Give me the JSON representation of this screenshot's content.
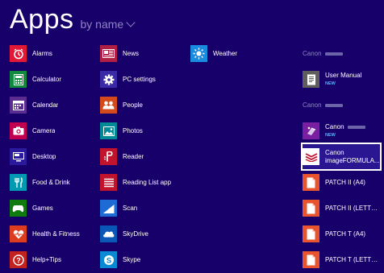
{
  "header": {
    "title": "Apps",
    "sort_label": "by name"
  },
  "columns": [
    {
      "items": [
        {
          "label": "Alarms",
          "icon": "alarm-icon",
          "color": "#e31837"
        },
        {
          "label": "Calculator",
          "icon": "calculator-icon",
          "color": "#118a3e"
        },
        {
          "label": "Calendar",
          "icon": "calendar-icon",
          "color": "#5c2d91"
        },
        {
          "label": "Camera",
          "icon": "camera-icon",
          "color": "#c1004f"
        },
        {
          "label": "Desktop",
          "icon": "desktop-icon",
          "color": "#2b1b9c"
        },
        {
          "label": "Food & Drink",
          "icon": "food-drink-icon",
          "color": "#009ab3"
        },
        {
          "label": "Games",
          "icon": "games-icon",
          "color": "#0f7b0f"
        },
        {
          "label": "Health & Fitness",
          "icon": "health-fitness-icon",
          "color": "#dd3c1f"
        },
        {
          "label": "Help+Tips",
          "icon": "help-icon",
          "color": "#c4221f"
        }
      ]
    },
    {
      "items": [
        {
          "label": "News",
          "icon": "news-icon",
          "color": "#b01e45"
        },
        {
          "label": "PC settings",
          "icon": "gear-icon",
          "color": "#3a2aa6"
        },
        {
          "label": "People",
          "icon": "people-icon",
          "color": "#d44a1c"
        },
        {
          "label": "Photos",
          "icon": "photos-icon",
          "color": "#008a96"
        },
        {
          "label": "Reader",
          "icon": "reader-icon",
          "color": "#c1122e"
        },
        {
          "label": "Reading List app",
          "icon": "reading-list-icon",
          "color": "#c1122e"
        },
        {
          "label": "Scan",
          "icon": "scan-icon",
          "color": "#1e6bd6"
        },
        {
          "label": "SkyDrive",
          "icon": "skydrive-icon",
          "color": "#0a57b8"
        },
        {
          "label": "Skype",
          "icon": "skype-icon",
          "color": "#0a8ad4"
        }
      ]
    },
    {
      "items": [
        {
          "label": "Weather",
          "icon": "weather-icon",
          "color": "#1a8ce0"
        }
      ]
    },
    {
      "group1": "Canon",
      "user_manual": {
        "label": "User Manual",
        "badge": "NEW",
        "icon": "document-icon",
        "color": "#605e5c"
      },
      "group2": "Canon",
      "canon_app": {
        "label": "Canon",
        "badge": "NEW",
        "icon": "canon-app-icon",
        "color": "#7a1fa2"
      },
      "canon_image": {
        "line1": "Canon",
        "line2": "imageFORMULA...",
        "icon": "imageformula-icon",
        "color": "#ffffff"
      },
      "patches": [
        {
          "label": "PATCH II (A4)",
          "icon": "document-icon",
          "color": "#e8542e"
        },
        {
          "label": "PATCH II (LETTER)",
          "icon": "document-icon",
          "color": "#e8542e"
        },
        {
          "label": "PATCH T (A4)",
          "icon": "document-icon",
          "color": "#e8542e"
        },
        {
          "label": "PATCH T (LETTER)",
          "icon": "document-icon",
          "color": "#e8542e"
        }
      ]
    }
  ]
}
